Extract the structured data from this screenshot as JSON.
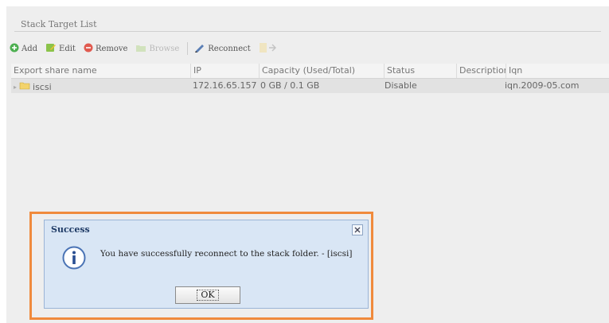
{
  "panel": {
    "legend": "Stack Target List"
  },
  "toolbar": {
    "add_label": "Add",
    "edit_label": "Edit",
    "remove_label": "Remove",
    "faded1_label": "Browse",
    "reconnect_label": "Reconnect"
  },
  "grid": {
    "columns": [
      "Export share name",
      "IP",
      "Capacity (Used/Total)",
      "Status",
      "Description",
      "Iqn"
    ],
    "rows": [
      {
        "name": "iscsi",
        "ip": "172.16.65.157",
        "capacity": "0 GB / 0.1 GB",
        "status": "Disable",
        "description": "",
        "iqn": "iqn.2009-05.com"
      }
    ]
  },
  "dialog": {
    "title": "Success",
    "message": "You have successfully reconnect to the stack folder. - [iscsi]",
    "ok_label": "OK"
  },
  "colors": {
    "highlight": "#f08a3c",
    "dialog_bg": "#d9e6f5",
    "add_icon": "#4caf50",
    "remove_icon": "#e05a4f"
  },
  "icons": {
    "add": "plus-circle-icon",
    "edit": "edit-icon",
    "remove": "minus-circle-icon",
    "reconnect": "pencil-icon",
    "info": "info-icon",
    "close": "close-icon",
    "folder": "folder-icon"
  }
}
